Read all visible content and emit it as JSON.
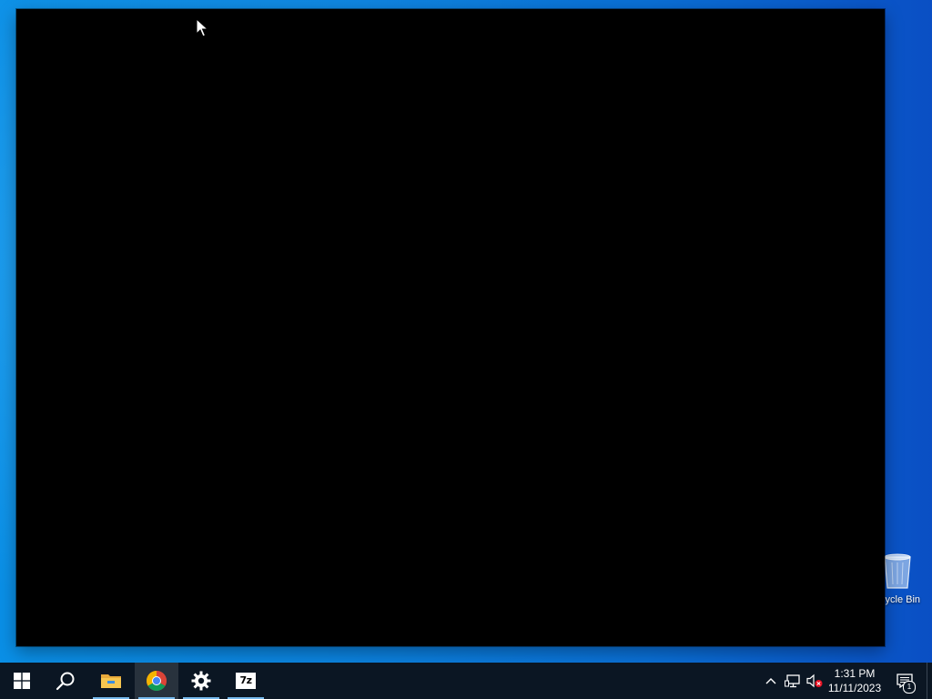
{
  "desktop": {
    "recycle_bin_label": "Recycle Bin",
    "recycle_bin_visible_label": "cle Bin"
  },
  "window": {
    "content": "black"
  },
  "taskbar": {
    "start_icon": "windows-logo-icon",
    "search_icon": "search-icon",
    "pinned": [
      {
        "name": "file-explorer",
        "icon": "folder-icon",
        "running": true,
        "active": false
      },
      {
        "name": "google-chrome",
        "icon": "chrome-icon",
        "running": true,
        "active": true
      },
      {
        "name": "settings",
        "icon": "gear-icon",
        "running": true,
        "active": false
      },
      {
        "name": "7-zip",
        "icon": "7zip-icon",
        "label": "7z",
        "running": true,
        "active": false
      }
    ],
    "tray": {
      "overflow_icon": "chevron-up-icon",
      "network_icon": "network-icon",
      "volume_icon": "volume-muted-icon"
    },
    "clock": {
      "time": "1:31 PM",
      "date": "11/11/2023"
    },
    "notifications": {
      "icon": "action-center-icon",
      "count": "1"
    }
  },
  "colors": {
    "taskbar_bg": "#0b1623",
    "accent_underline": "#76b9ed",
    "desktop_blue": "#0a84e0"
  }
}
